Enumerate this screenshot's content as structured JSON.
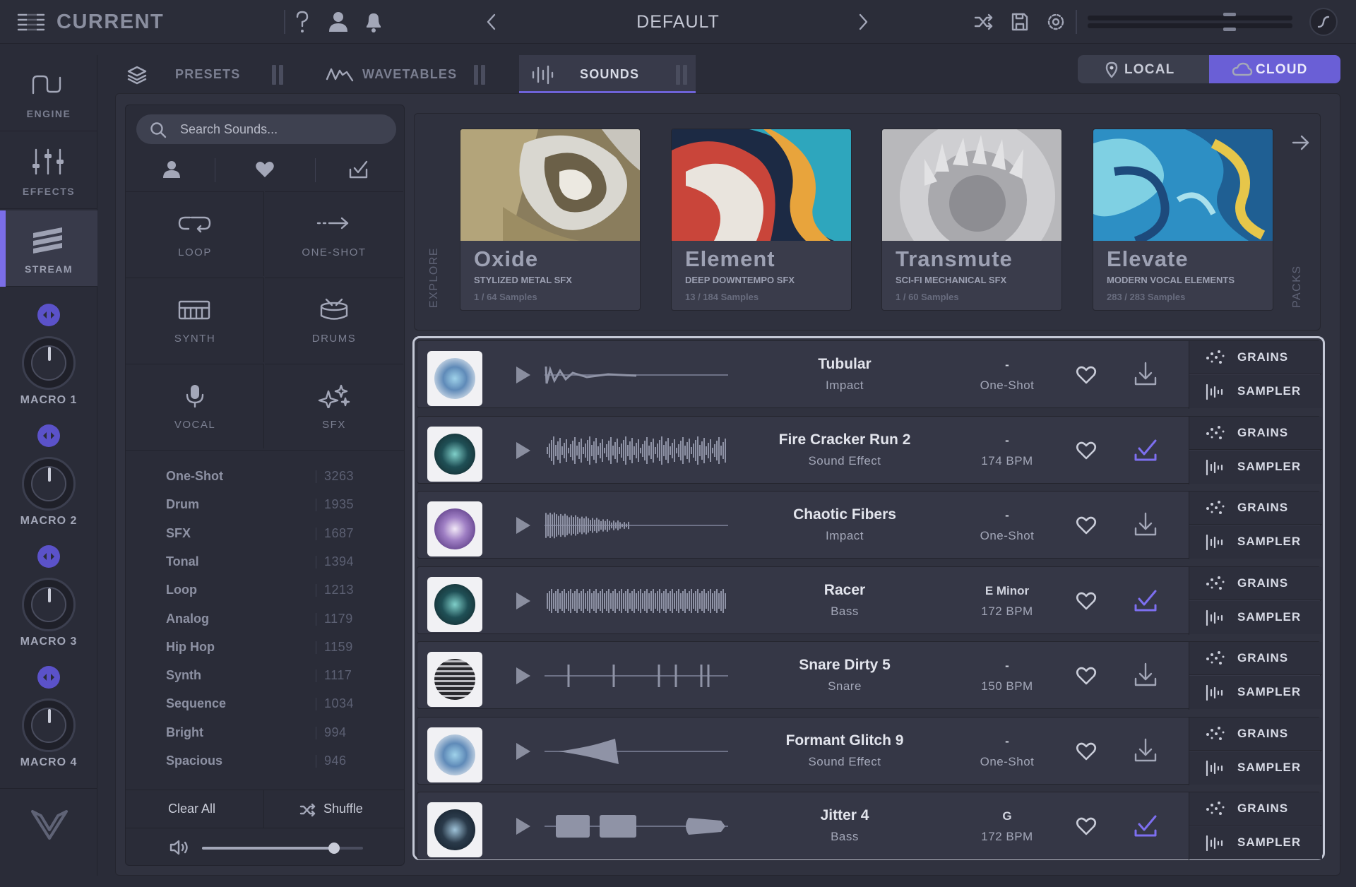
{
  "app": {
    "title": "CURRENT",
    "preset_name": "DEFAULT"
  },
  "sidebar": {
    "items": [
      {
        "label": "ENGINE",
        "icon": "engine-wave-icon"
      },
      {
        "label": "EFFECTS",
        "icon": "sliders-icon"
      },
      {
        "label": "STREAM",
        "icon": "stream-icon",
        "active": true
      }
    ],
    "macros": [
      "MACRO 1",
      "MACRO 2",
      "MACRO 3",
      "MACRO 4"
    ]
  },
  "tabs": [
    {
      "label": "PRESETS",
      "icon": "layers-icon"
    },
    {
      "label": "WAVETABLES",
      "icon": "wavetable-icon"
    },
    {
      "label": "SOUNDS",
      "icon": "sounds-icon",
      "active": true
    }
  ],
  "source_toggle": {
    "local": "LOCAL",
    "cloud": "CLOUD",
    "selected": "CLOUD"
  },
  "search": {
    "placeholder": "Search Sounds..."
  },
  "categories": [
    {
      "label": "LOOP",
      "icon": "loop-icon"
    },
    {
      "label": "ONE-SHOT",
      "icon": "one-shot-icon"
    },
    {
      "label": "SYNTH",
      "icon": "synth-keyboard-icon"
    },
    {
      "label": "DRUMS",
      "icon": "drum-icon"
    },
    {
      "label": "VOCAL",
      "icon": "microphone-icon"
    },
    {
      "label": "SFX",
      "icon": "sparkle-icon"
    }
  ],
  "tags": [
    {
      "name": "One-Shot",
      "count": "3263"
    },
    {
      "name": "Drum",
      "count": "1935"
    },
    {
      "name": "SFX",
      "count": "1687"
    },
    {
      "name": "Tonal",
      "count": "1394"
    },
    {
      "name": "Loop",
      "count": "1213"
    },
    {
      "name": "Analog",
      "count": "1179"
    },
    {
      "name": "Hip Hop",
      "count": "1159"
    },
    {
      "name": "Synth",
      "count": "1117"
    },
    {
      "name": "Sequence",
      "count": "1034"
    },
    {
      "name": "Bright",
      "count": "994"
    },
    {
      "name": "Spacious",
      "count": "946"
    }
  ],
  "filter_actions": {
    "clear_all": "Clear All",
    "shuffle": "Shuffle"
  },
  "preview_volume": 0.82,
  "packs_panel": {
    "explore_label": "EXPLORE",
    "packs_label": "PACKS"
  },
  "packs": [
    {
      "name": "Oxide",
      "subtitle": "STYLIZED METAL SFX",
      "count": "1 / 64 Samples"
    },
    {
      "name": "Element",
      "subtitle": "DEEP DOWNTEMPO SFX",
      "count": "13 / 184 Samples"
    },
    {
      "name": "Transmute",
      "subtitle": "SCI-FI MECHANICAL SFX",
      "count": "1 / 60 Samples"
    },
    {
      "name": "Elevate",
      "subtitle": "MODERN VOCAL ELEMENTS",
      "count": "283 / 283 Samples"
    }
  ],
  "engine_buttons": {
    "grains": "GRAINS",
    "sampler": "SAMPLER"
  },
  "sounds": [
    {
      "name": "Tubular",
      "category": "Impact",
      "key": "-",
      "bpm": "One-Shot",
      "downloaded": false
    },
    {
      "name": "Fire Cracker Run 2",
      "category": "Sound Effect",
      "key": "-",
      "bpm": "174 BPM",
      "downloaded": true
    },
    {
      "name": "Chaotic Fibers",
      "category": "Impact",
      "key": "-",
      "bpm": "One-Shot",
      "downloaded": false
    },
    {
      "name": "Racer",
      "category": "Bass",
      "key": "E Minor",
      "bpm": "172 BPM",
      "downloaded": true
    },
    {
      "name": "Snare Dirty 5",
      "category": "Snare",
      "key": "-",
      "bpm": "150 BPM",
      "downloaded": false
    },
    {
      "name": "Formant Glitch 9",
      "category": "Sound Effect",
      "key": "-",
      "bpm": "One-Shot",
      "downloaded": false
    },
    {
      "name": "Jitter 4",
      "category": "Bass",
      "key": "G",
      "bpm": "172 BPM",
      "downloaded": true
    }
  ],
  "colors": {
    "accent": "#6e63d8",
    "background": "#2a2c38",
    "panel": "#30323f"
  }
}
